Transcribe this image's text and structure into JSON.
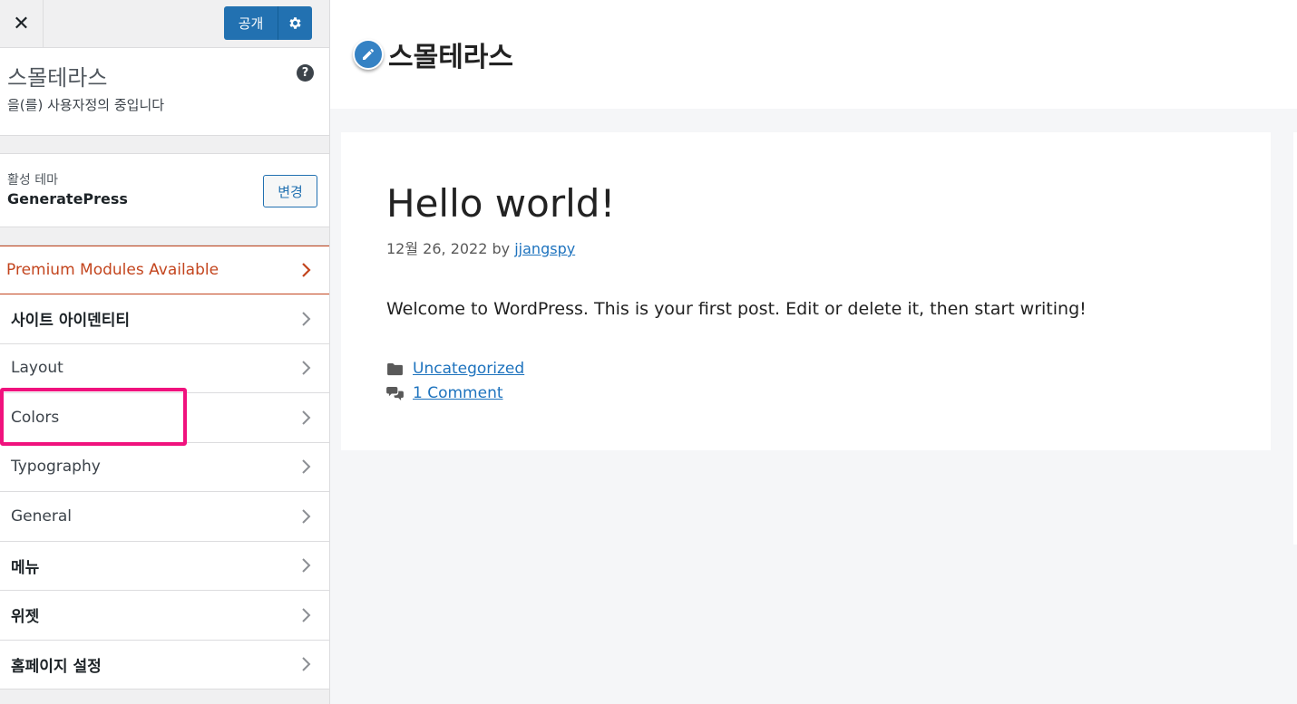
{
  "header": {
    "publish_label": "공개"
  },
  "info": {
    "title": "스몰테라스",
    "subtitle": "을(를) 사용자정의 중입니다"
  },
  "theme": {
    "label": "활성 테마",
    "name": "GeneratePress",
    "change_label": "변경"
  },
  "menu": {
    "premium": "Premium Modules Available",
    "items": [
      "사이트 아이덴티티",
      "Layout",
      "Colors",
      "Typography",
      "General",
      "메뉴",
      "위젯",
      "홈페이지 설정"
    ]
  },
  "preview": {
    "site_title": "스몰테라스",
    "post_title": "Hello world!",
    "post_date": "12월 26, 2022",
    "by": "by",
    "author": "jjangspy",
    "body": "Welcome to WordPress. This is your first post. Edit or delete it, then start writing!",
    "category": "Uncategorized",
    "comments": "1 Comment"
  },
  "colors": {
    "accent": "#2271b1",
    "premium": "#c3451e",
    "highlight": "#f0127d",
    "link": "#1e73be"
  },
  "icons": [
    "close-icon",
    "gear-icon",
    "help-icon",
    "chevron-right-icon",
    "pencil-icon",
    "folder-icon",
    "comments-icon"
  ]
}
